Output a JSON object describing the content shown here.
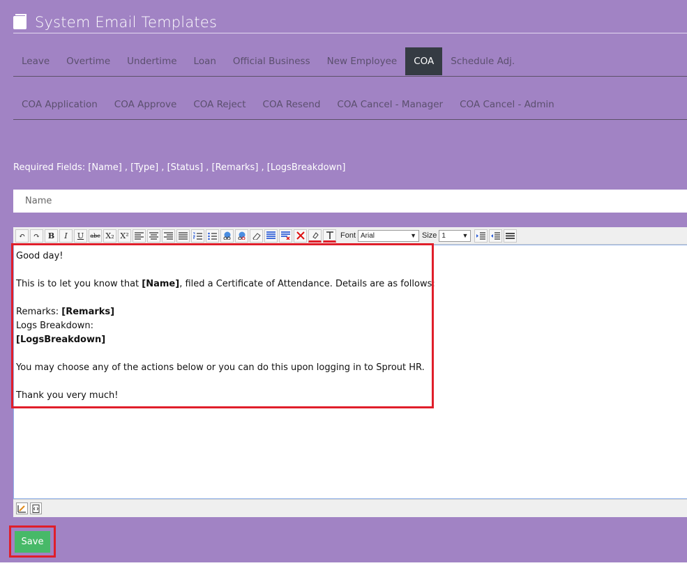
{
  "page": {
    "title": "System Email Templates",
    "title_icon": "book-icon"
  },
  "tabs": [
    {
      "label": "Leave",
      "active": false
    },
    {
      "label": "Overtime",
      "active": false
    },
    {
      "label": "Undertime",
      "active": false
    },
    {
      "label": "Loan",
      "active": false
    },
    {
      "label": "Official Business",
      "active": false
    },
    {
      "label": "New Employee",
      "active": false
    },
    {
      "label": "COA",
      "active": true
    },
    {
      "label": "Schedule Adj.",
      "active": false
    }
  ],
  "subtabs": [
    {
      "label": "COA Application"
    },
    {
      "label": "COA Approve"
    },
    {
      "label": "COA Reject"
    },
    {
      "label": "COA Resend"
    },
    {
      "label": "COA Cancel - Manager"
    },
    {
      "label": "COA Cancel - Admin"
    }
  ],
  "required_fields": "Required Fields: [Name] , [Type] , [Status] , [Remarks] , [LogsBreakdown]",
  "name_input": {
    "placeholder": "Name",
    "value": ""
  },
  "toolbar": {
    "undo": "↶",
    "redo": "↷",
    "bold": "B",
    "italic": "I",
    "underline": "U",
    "strike": "abc",
    "subscript": "X₂",
    "superscript": "X²",
    "font_label": "Font",
    "font_value": "Arial",
    "size_label": "Size",
    "size_value": "1",
    "dropdown_arrow": "▼"
  },
  "body": {
    "line1": "Good day!",
    "line2_pre": "This is to let you know that ",
    "line2_bold": "[Name]",
    "line2_post": ", filed a Certificate of Attendance. Details are as follows:",
    "remarks_label": "Remarks: ",
    "remarks_value": "[Remarks]",
    "logs_label": "Logs Breakdown:",
    "logs_value": "[LogsBreakdown]",
    "line_actions": "You may choose any of the actions below or you can do this upon logging in to Sprout HR.",
    "thanks": "Thank you very much!"
  },
  "save_label": "Save",
  "colors": {
    "panel": "#a183c4",
    "active_tab": "#353b43",
    "save_button": "#47b968",
    "highlight": "#e01e2a"
  }
}
